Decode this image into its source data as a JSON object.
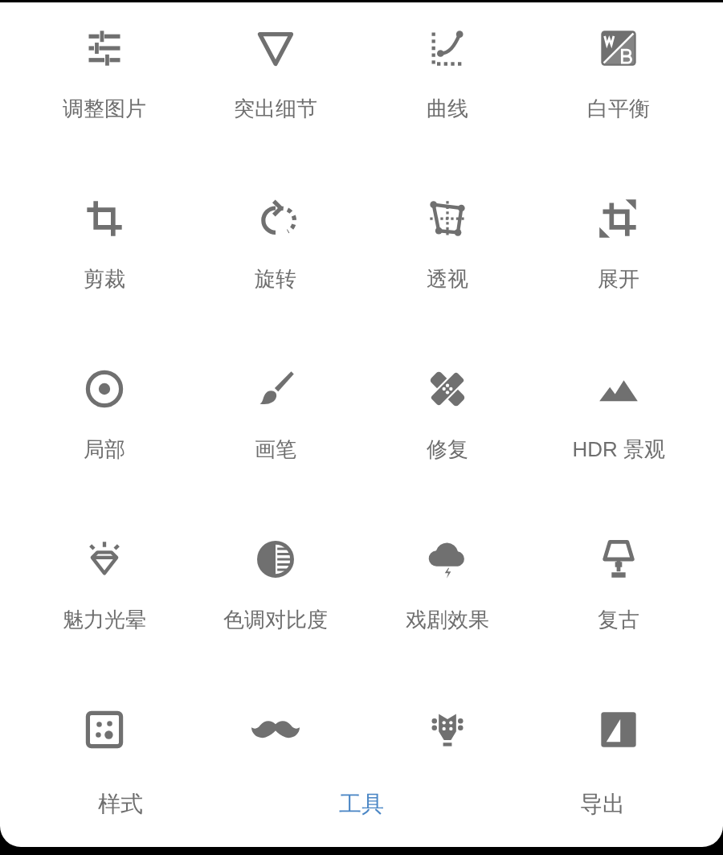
{
  "tools": [
    {
      "kind": "labeled",
      "label": "调整图片"
    },
    {
      "kind": "labeled",
      "label": "突出细节"
    },
    {
      "kind": "labeled",
      "label": "曲线"
    },
    {
      "kind": "labeled",
      "label": "白平衡"
    },
    {
      "kind": "labeled",
      "label": "剪裁"
    },
    {
      "kind": "labeled",
      "label": "旋转"
    },
    {
      "kind": "labeled",
      "label": "透视"
    },
    {
      "kind": "labeled",
      "label": "展开"
    },
    {
      "kind": "labeled",
      "label": "局部"
    },
    {
      "kind": "labeled",
      "label": "画笔"
    },
    {
      "kind": "labeled",
      "label": "修复"
    },
    {
      "kind": "labeled",
      "label": "HDR 景观"
    },
    {
      "kind": "labeled",
      "label": "魅力光晕"
    },
    {
      "kind": "labeled",
      "label": "色调对比度"
    },
    {
      "kind": "labeled",
      "label": "戏剧效果"
    },
    {
      "kind": "labeled",
      "label": "复古"
    },
    {
      "kind": "unlabeled"
    },
    {
      "kind": "unlabeled"
    },
    {
      "kind": "unlabeled"
    },
    {
      "kind": "unlabeled"
    }
  ],
  "tabs": [
    {
      "label": "样式",
      "selected": false
    },
    {
      "label": "工具",
      "selected": true
    },
    {
      "label": "导出",
      "selected": false
    }
  ]
}
